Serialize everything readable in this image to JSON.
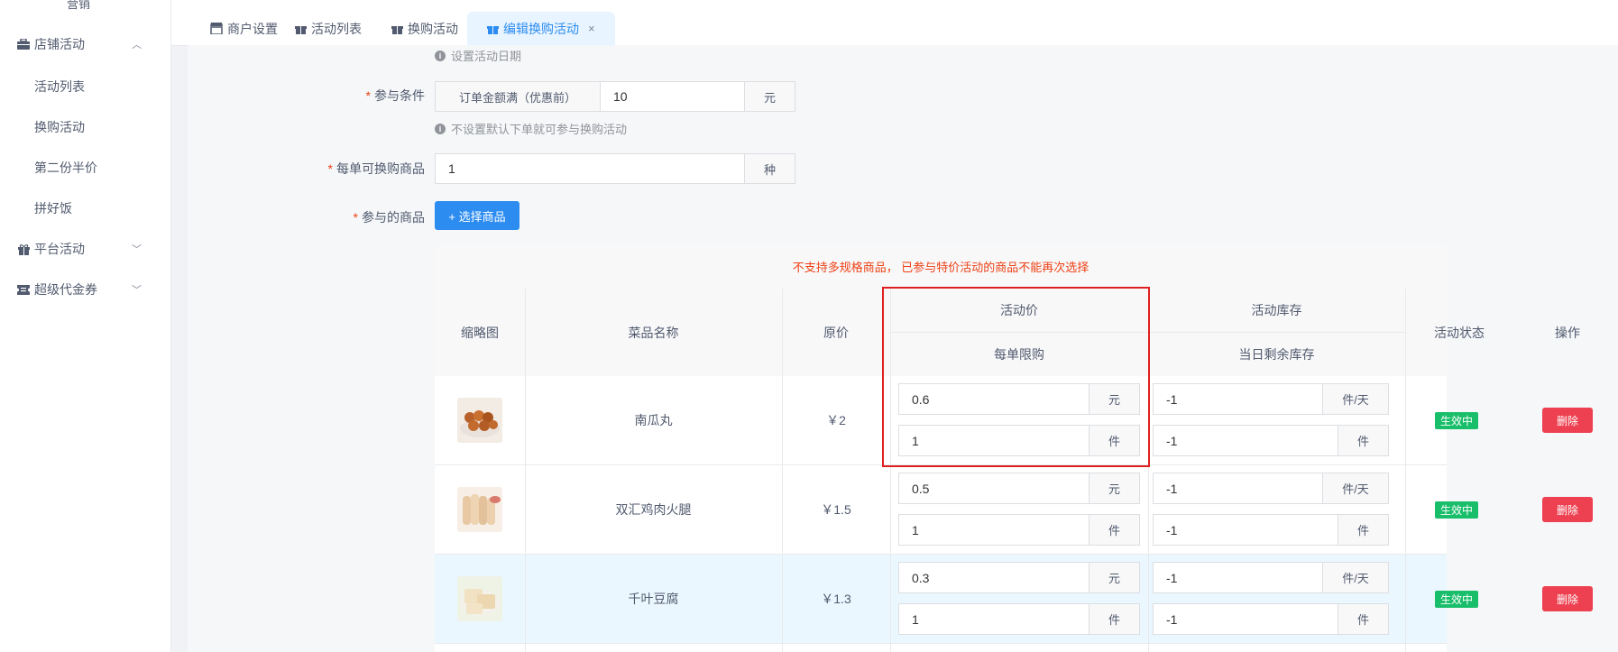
{
  "sidebar": {
    "top_label": "营销",
    "groups": [
      {
        "label": "店铺活动",
        "icon": "briefcase-icon"
      },
      {
        "label": "平台活动",
        "icon": "gift-icon"
      },
      {
        "label": "超级代金券",
        "icon": "ticket-icon"
      }
    ],
    "items": [
      "活动列表",
      "换购活动",
      "第二份半价",
      "拼好饭"
    ]
  },
  "tabs": [
    {
      "label": "商户设置",
      "icon": "store-icon"
    },
    {
      "label": "活动列表",
      "icon": "gift-icon"
    },
    {
      "label": "换购活动",
      "icon": "gift-icon"
    },
    {
      "label": "编辑换购活动",
      "icon": "gift-icon",
      "active": true
    }
  ],
  "form": {
    "date_tip": "设置活动日期",
    "condition_label": "参与条件",
    "condition_prefix": "订单金额满（优惠前）",
    "condition_value": "10",
    "condition_suffix": "元",
    "condition_tip": "不设置默认下单就可参与换购活动",
    "per_order_label": "每单可换购商品",
    "per_order_value": "1",
    "per_order_suffix": "种",
    "goods_label": "参与的商品",
    "select_button": "+ 选择商品"
  },
  "table": {
    "notice": "不支持多规格商品， 已参与特价活动的商品不能再次选择",
    "headers": {
      "thumb": "缩略图",
      "name": "菜品名称",
      "price": "原价",
      "act_price": "活动价",
      "limit": "每单限购",
      "stock": "活动库存",
      "remain": "当日剩余库存",
      "status": "活动状态",
      "op": "操作"
    },
    "rows": [
      {
        "name": "南瓜丸",
        "price": "￥2",
        "act_price": "0.6",
        "price_unit": "元",
        "limit": "1",
        "limit_unit": "件",
        "stock": "-1",
        "stock_unit": "件/天",
        "remain": "-1",
        "remain_unit": "件",
        "status": "生效中",
        "delete": "删除"
      },
      {
        "name": "双汇鸡肉火腿",
        "price": "￥1.5",
        "act_price": "0.5",
        "price_unit": "元",
        "limit": "1",
        "limit_unit": "件",
        "stock": "-1",
        "stock_unit": "件/天",
        "remain": "-1",
        "remain_unit": "件",
        "status": "生效中",
        "delete": "删除"
      },
      {
        "name": "千叶豆腐",
        "price": "￥1.3",
        "act_price": "0.3",
        "price_unit": "元",
        "limit": "1",
        "limit_unit": "件",
        "stock": "-1",
        "stock_unit": "件/天",
        "remain": "-1",
        "remain_unit": "件",
        "status": "生效中",
        "delete": "删除"
      }
    ]
  },
  "colors": {
    "primary": "#2d8cf0",
    "danger": "#ed4050",
    "success": "#19be6b",
    "highlight_box": "#e02020"
  }
}
